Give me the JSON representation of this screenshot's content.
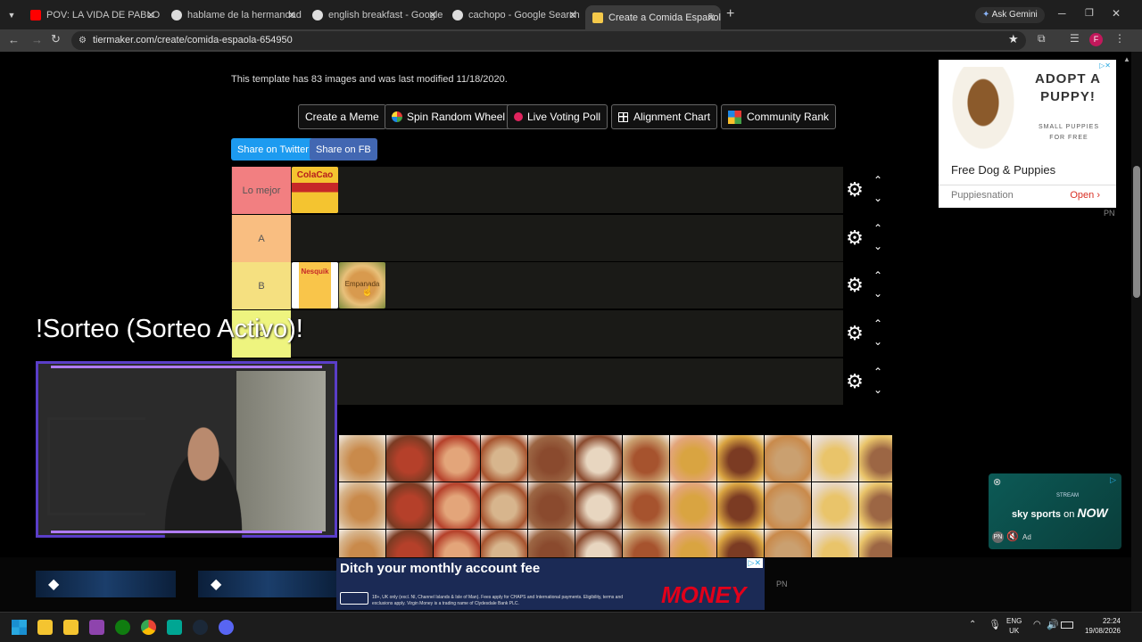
{
  "browser": {
    "tabs": [
      {
        "label": "POV: LA VIDA DE PABLO CON",
        "fav": "#ff0000"
      },
      {
        "label": "hablame de la hermandad mus",
        "fav": "#4285f4"
      },
      {
        "label": "english breakfast - Google Sea",
        "fav": "#4285f4"
      },
      {
        "label": "cachopo - Google Search",
        "fav": "#4285f4"
      },
      {
        "label": "Create a Comida Española Tier",
        "fav": "#f5c94a"
      }
    ],
    "new_tab": "+",
    "gemini": "Ask Gemini",
    "url": "tiermaker.com/create/comida-espaola-654950",
    "profile_initial": "F"
  },
  "page": {
    "template_info": "This template has 83 images and was last modified 11/18/2020.",
    "buttons": {
      "meme": "Create a Meme",
      "wheel": "Spin Random Wheel",
      "poll": "Live Voting Poll",
      "alignment": "Alignment Chart",
      "community": "Community Rank"
    },
    "share": {
      "twitter": "Share on Twitter",
      "fb": "Share on FB"
    },
    "tiers": [
      {
        "label": "Lo mejor",
        "color": "#f27f81"
      },
      {
        "label": "A",
        "color": "#f9be81"
      },
      {
        "label": "B",
        "color": "#f5e080"
      },
      {
        "label": "C",
        "color": "#eef47f"
      },
      {
        "label": "",
        "color": "#1a1a17"
      }
    ],
    "tier_items": [
      "ColaCao",
      "Nesquik",
      "Empanada"
    ]
  },
  "ad_dog": {
    "headline": "ADOPT A PUPPY!",
    "sub": "SMALL PUPPIES FOR FREE",
    "title": "Free Dog & Puppies",
    "source": "Puppiesnation",
    "open": "Open",
    "pn": "PN"
  },
  "ad_sky": {
    "stream": "STREAM",
    "brand": "sky sports",
    "on": "on",
    "now": "NOW",
    "ad": "Ad"
  },
  "ad_money": {
    "headline": "Ditch your monthly account fee",
    "fine": "18+, UK only (excl. NI, Channel Islands & Isle of Man). Fees apply for CHAPS and International payments. Eligibility, terms and exclusions apply. Virgin Money is a trading name of Clydesdale Bank PLC.",
    "brand": "MONEY",
    "pn": "PN"
  },
  "overlay": {
    "giveaway": "!Sorteo (Sorteo Activo)!"
  },
  "taskbar": {
    "lang": "ENG",
    "region": "UK",
    "time": "22:24",
    "date": "19/08/2026"
  },
  "colors": {
    "twitter": "#1d9bf0",
    "fb": "#4267b2",
    "overlay_frame": "#5a3ec8"
  }
}
